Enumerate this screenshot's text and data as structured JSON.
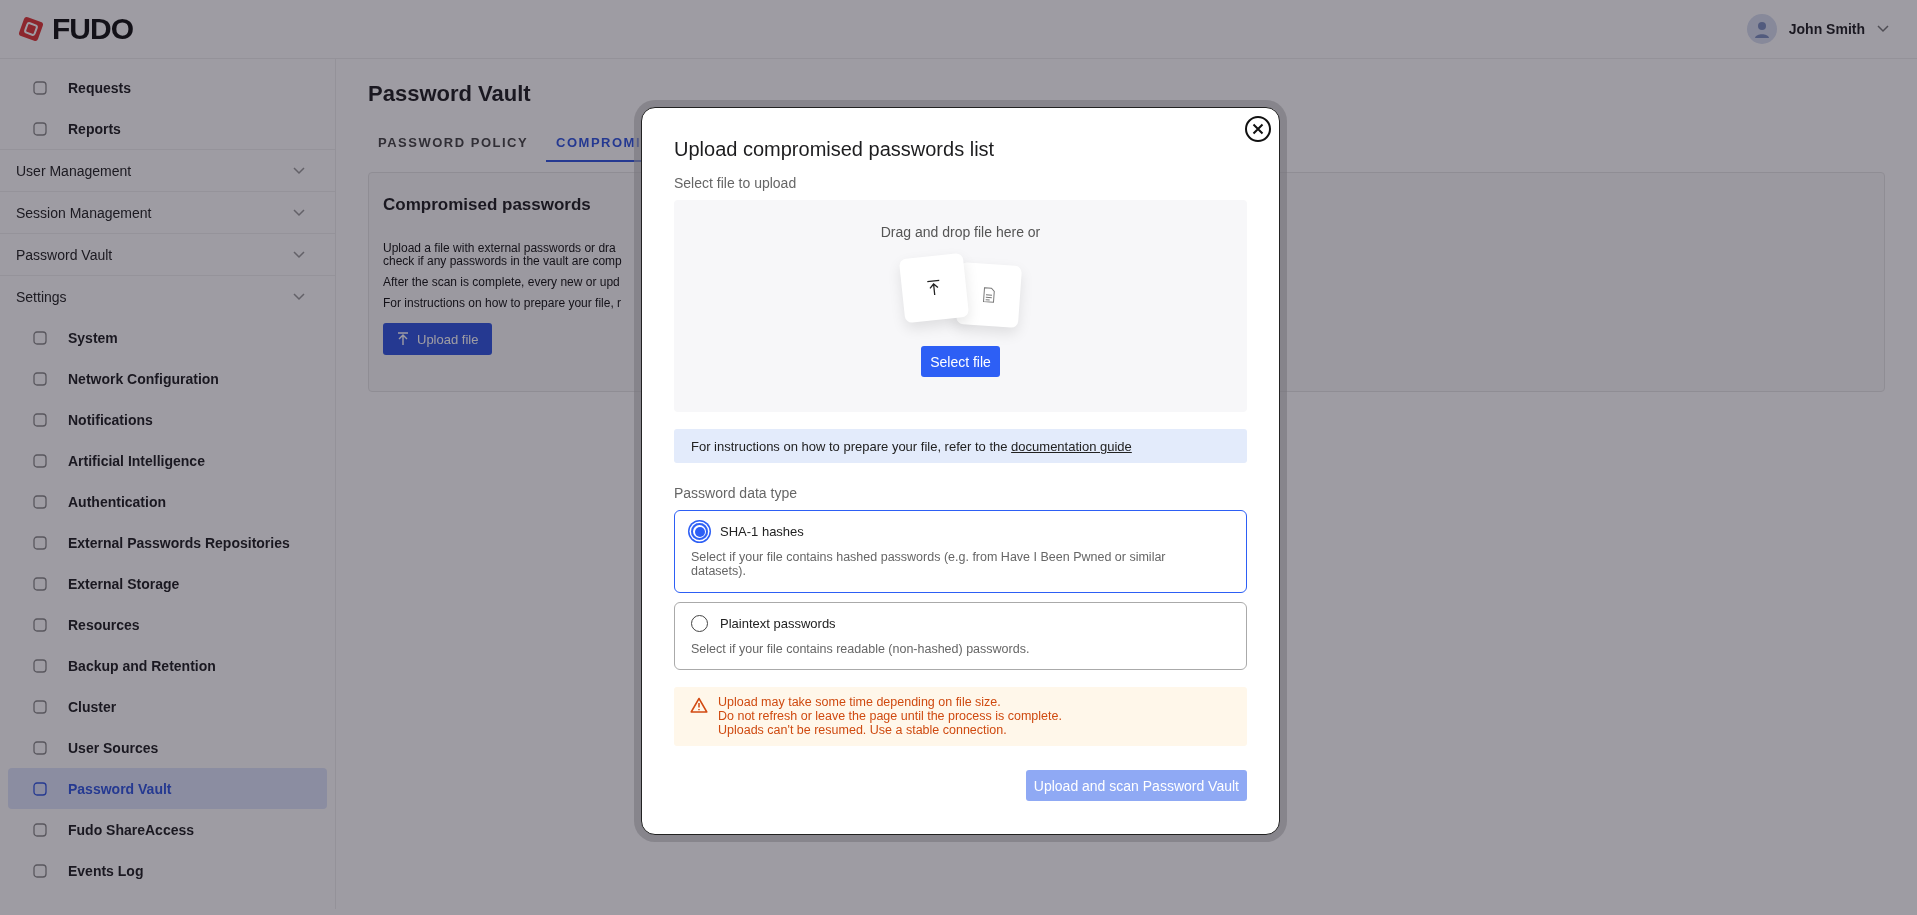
{
  "header": {
    "logo": "FUDO",
    "user": {
      "name": "John Smith"
    }
  },
  "sidebar": {
    "items": [
      {
        "kind": "link",
        "label": "Requests",
        "selected": false
      },
      {
        "kind": "link",
        "label": "Reports",
        "selected": false
      },
      {
        "kind": "group",
        "label": "User Management"
      },
      {
        "kind": "group",
        "label": "Session Management"
      },
      {
        "kind": "group",
        "label": "Password Vault"
      },
      {
        "kind": "group",
        "label": "Settings"
      },
      {
        "kind": "link",
        "label": "System",
        "selected": false
      },
      {
        "kind": "link",
        "label": "Network Configuration",
        "selected": false
      },
      {
        "kind": "link",
        "label": "Notifications",
        "selected": false
      },
      {
        "kind": "link",
        "label": "Artificial Intelligence",
        "selected": false
      },
      {
        "kind": "link",
        "label": "Authentication",
        "selected": false
      },
      {
        "kind": "link",
        "label": "External Passwords Repositories",
        "selected": false
      },
      {
        "kind": "link",
        "label": "External Storage",
        "selected": false
      },
      {
        "kind": "link",
        "label": "Resources",
        "selected": false
      },
      {
        "kind": "link",
        "label": "Backup and Retention",
        "selected": false
      },
      {
        "kind": "link",
        "label": "Cluster",
        "selected": false
      },
      {
        "kind": "link",
        "label": "User Sources",
        "selected": false
      },
      {
        "kind": "link",
        "label": "Password Vault",
        "selected": true
      },
      {
        "kind": "link",
        "label": "Fudo ShareAccess",
        "selected": false
      },
      {
        "kind": "link",
        "label": "Events Log",
        "selected": false
      }
    ]
  },
  "page": {
    "title": "Password Vault",
    "tabs": [
      {
        "label": "PASSWORD POLICY",
        "selected": false
      },
      {
        "label": "COMPROMI",
        "selected": true
      }
    ],
    "card": {
      "title": "Compromised passwords",
      "paragraphs": [
        "Upload a file with external passwords or dra",
        "check if any passwords in the vault are comp",
        "After the scan is complete, every new or upd",
        "For instructions on how to prepare your file, r"
      ],
      "button": "Upload file"
    }
  },
  "modal": {
    "title": "Upload compromised passwords list",
    "file_label": "Select file to upload",
    "dropzone": {
      "text": "Drag and drop file here or",
      "button": "Select file"
    },
    "info": {
      "text": "For instructions on how to prepare your file, refer to the ",
      "link": "documentation guide"
    },
    "type_label": "Password data type",
    "options": [
      {
        "title": "SHA-1 hashes",
        "description": "Select if your file contains hashed passwords (e.g. from Have I Been Pwned or similar datasets).",
        "selected": true
      },
      {
        "title": "Plaintext passwords",
        "description": "Select if your file contains readable (non-hashed) passwords.",
        "selected": false
      }
    ],
    "warning": [
      "Upload may take some time depending on file size.",
      "Do not refresh or leave the page until the process is complete.",
      "Uploads can't be resumed. Use a stable connection."
    ],
    "submit": {
      "label": "Upload and scan Password Vault",
      "disabled": true
    }
  }
}
